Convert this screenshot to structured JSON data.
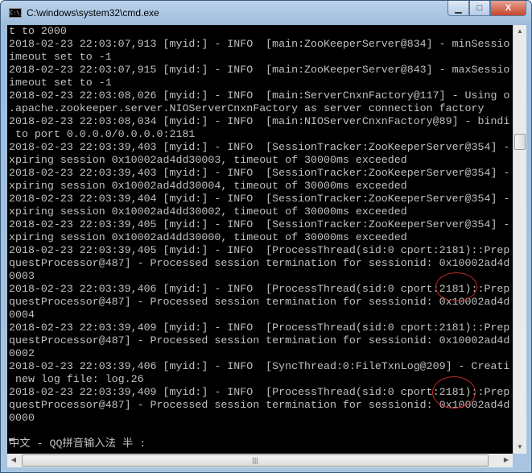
{
  "window": {
    "title": "C:\\windows\\system32\\cmd.exe",
    "icon_text": "C:\\_",
    "minimize": "▁",
    "maximize": "□",
    "close": "X"
  },
  "console": {
    "lines": [
      "t to 2000",
      "2018-02-23 22:03:07,913 [myid:] - INFO  [main:ZooKeeperServer@834] - minSessio",
      "imeout set to -1",
      "2018-02-23 22:03:07,915 [myid:] - INFO  [main:ZooKeeperServer@843] - maxSessio",
      "imeout set to -1",
      "2018-02-23 22:03:08,026 [myid:] - INFO  [main:ServerCnxnFactory@117] - Using o",
      ".apache.zookeeper.server.NIOServerCnxnFactory as server connection factory",
      "2018-02-23 22:03:08,034 [myid:] - INFO  [main:NIOServerCnxnFactory@89] - bindi",
      " to port 0.0.0.0/0.0.0.0:2181",
      "2018-02-23 22:03:39,403 [myid:] - INFO  [SessionTracker:ZooKeeperServer@354] -",
      "xpiring session 0x10002ad4dd30003, timeout of 30000ms exceeded",
      "2018-02-23 22:03:39,403 [myid:] - INFO  [SessionTracker:ZooKeeperServer@354] -",
      "xpiring session 0x10002ad4dd30004, timeout of 30000ms exceeded",
      "2018-02-23 22:03:39,404 [myid:] - INFO  [SessionTracker:ZooKeeperServer@354] -",
      "xpiring session 0x10002ad4dd30002, timeout of 30000ms exceeded",
      "2018-02-23 22:03:39,405 [myid:] - INFO  [SessionTracker:ZooKeeperServer@354] -",
      "xpiring session 0x10002ad4dd30000, timeout of 30000ms exceeded",
      "2018-02-23 22:03:39,405 [myid:] - INFO  [ProcessThread(sid:0 cport:2181)::Prep",
      "questProcessor@487] - Processed session termination for sessionid: 0x10002ad4d",
      "0003",
      "2018-02-23 22:03:39,406 [myid:] - INFO  [ProcessThread(sid:0 cport:2181)::Prep",
      "questProcessor@487] - Processed session termination for sessionid: 0x10002ad4d",
      "0004",
      "2018-02-23 22:03:39,409 [myid:] - INFO  [ProcessThread(sid:0 cport:2181)::Prep",
      "questProcessor@487] - Processed session termination for sessionid: 0x10002ad4d",
      "0002",
      "2018-02-23 22:03:39,406 [myid:] - INFO  [SyncThread:0:FileTxnLog@209] - Creati",
      " new log file: log.26",
      "2018-02-23 22:03:39,409 [myid:] - INFO  [ProcessThread(sid:0 cport:2181)::Prep",
      "questProcessor@487] - Processed session termination for sessionid: 0x10002ad4d",
      "0000",
      "",
      "中文 - QQ拼音输入法 半 :"
    ]
  },
  "annotation_color": "#c0282a"
}
